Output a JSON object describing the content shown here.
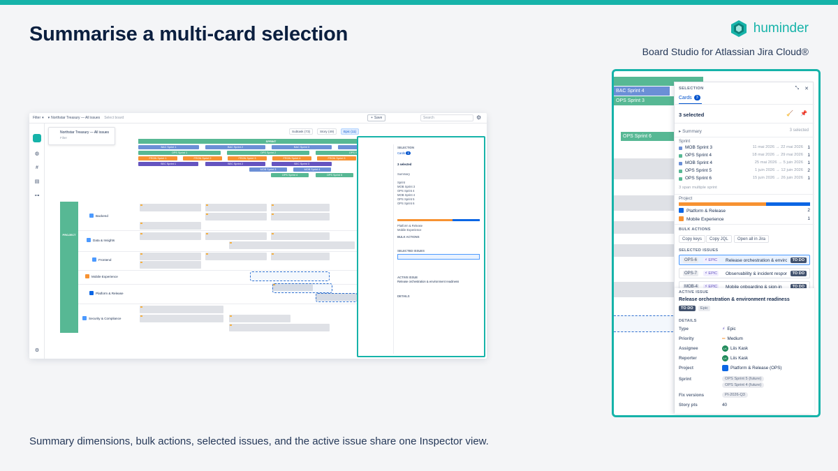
{
  "slide": {
    "title": "Summarise a multi-card selection",
    "brand_name": "huminder",
    "brand_subtitle": "Board Studio for Atlassian Jira Cloud®",
    "caption": "Summary dimensions, bulk actions, selected issues, and the active issue share one Inspector view.",
    "accent_color": "#16b3a9"
  },
  "board": {
    "filter_label": "Filter",
    "board_name": "Northstar Treasury — All issues",
    "board_placeholder": "Select board",
    "save_label": "Save",
    "search_placeholder": "Search",
    "popup_title": "Northstar Treasury — All issues",
    "popup_sub": "Filter",
    "toolbar": [
      "Subtask (73)",
      "Story (49)",
      "Epic (11)"
    ],
    "sprint_header": "SPRINT",
    "project_band": "PROJECT",
    "rows": [
      "Backend",
      "Data & Insights",
      "Frontend",
      "Mobile Experience",
      "Platform & Release",
      "Security & Compliance"
    ]
  },
  "inspector": {
    "header": "SELECTION",
    "tab_label": "Cards",
    "tab_count": "3",
    "selected_count": "3 selected",
    "summary_label": "Summary",
    "summary_right": "3 selected",
    "sprint_label": "Sprint",
    "sprints": [
      {
        "name": "MOB Sprint 3",
        "dates": "11 mai 2026 → 22 mai 2026",
        "count": "1",
        "color": "#6b8fd6"
      },
      {
        "name": "OPS Sprint 4",
        "dates": "18 mai 2026 → 29 mai 2026",
        "count": "1",
        "color": "#57b894"
      },
      {
        "name": "MOB Sprint 4",
        "dates": "25 mai 2026 → 5 juin 2026",
        "count": "1",
        "color": "#6b8fd6"
      },
      {
        "name": "OPS Sprint 5",
        "dates": "1 juin 2026 → 12 juin 2026",
        "count": "2",
        "color": "#57b894"
      },
      {
        "name": "OPS Sprint 6",
        "dates": "15 juin 2026 → 26 juin 2026",
        "count": "1",
        "color": "#57b894"
      }
    ],
    "sprint_note": "3 span multiple sprint",
    "project_label": "Project",
    "projects": [
      {
        "name": "Platform & Release",
        "count": "2",
        "color": "#0c66e4"
      },
      {
        "name": "Mobile Experience",
        "count": "1",
        "color": "#f79232"
      }
    ],
    "bulk_label": "BULK ACTIONS",
    "bulk_buttons": [
      "Copy keys",
      "Copy JQL",
      "Open all in Jira"
    ],
    "selected_label": "SELECTED ISSUES",
    "issues": [
      {
        "key": "OPS-6",
        "type": "EPIC",
        "summary": "Release orchestration & environment readiness",
        "status": "TO DO"
      },
      {
        "key": "OPS-7",
        "type": "EPIC",
        "summary": "Observability & incident response",
        "status": "TO DO"
      },
      {
        "key": "MOB-4",
        "type": "EPIC",
        "summary": "Mobile onboarding & sign-in",
        "status": "TO DO"
      }
    ],
    "active_label": "ACTIVE ISSUE",
    "active_title": "Release orchestration & environment readiness",
    "active_status": "TO DO",
    "active_type_chip": "Epic",
    "details_label": "DETAILS",
    "details": {
      "type_label": "Type",
      "type_value": "Epic",
      "priority_label": "Priority",
      "priority_value": "Medium",
      "assignee_label": "Assignee",
      "assignee_value": "Liis Kask",
      "assignee_initials": "LK",
      "reporter_label": "Reporter",
      "reporter_value": "Liis Kask",
      "reporter_initials": "LK",
      "project_label": "Project",
      "project_value": "Platform & Release (OPS)",
      "sprint_label": "Sprint",
      "sprint_values": [
        "OPS Sprint 5 (future)",
        "OPS Sprint 4 (future)"
      ],
      "fix_label": "Fix versions",
      "fix_value": "PI-2026-Q3",
      "points_label": "Story pts",
      "points_value": "40"
    }
  },
  "zoom_bars": [
    "BAC Sprint 4",
    "OPS Sprint 3",
    "OPS Sprint 6"
  ]
}
